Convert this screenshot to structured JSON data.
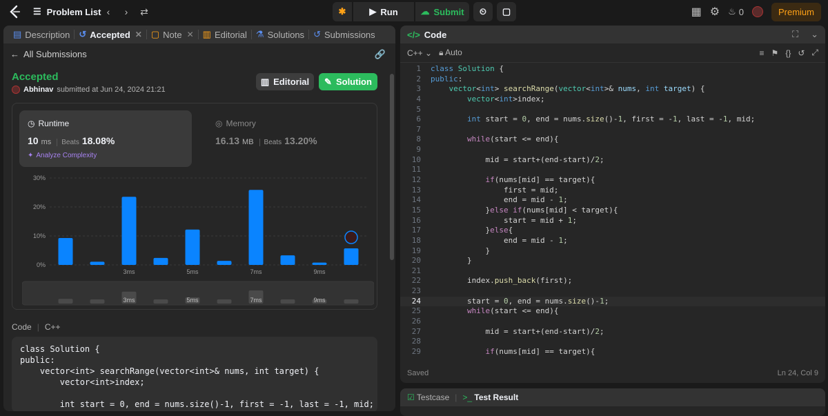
{
  "topbar": {
    "problem_list_label": "Problem List",
    "run_label": "Run",
    "submit_label": "Submit",
    "streak_count": "0",
    "premium_label": "Premium"
  },
  "left_tabs": [
    {
      "label": "Description"
    },
    {
      "label": "Accepted"
    },
    {
      "label": "Note"
    },
    {
      "label": "Editorial"
    },
    {
      "label": "Solutions"
    },
    {
      "label": "Submissions"
    }
  ],
  "submission": {
    "back_label": "All Submissions",
    "status": "Accepted",
    "user": "Abhinav",
    "submitted_text": "submitted at Jun 24, 2024 21:21",
    "editorial_btn": "Editorial",
    "solution_btn": "Solution",
    "runtime_title": "Runtime",
    "runtime_value": "10",
    "runtime_unit": "ms",
    "beats_label": "Beats",
    "runtime_beats": "18.08%",
    "analyze_label": "Analyze Complexity",
    "memory_title": "Memory",
    "memory_value": "16.13",
    "memory_unit": "MB",
    "memory_beats": "13.20%"
  },
  "chart_data": {
    "type": "bar",
    "y_ticks": [
      "30%",
      "20%",
      "10%",
      "0%"
    ],
    "x_tick_labels": [
      "3ms",
      "5ms",
      "7ms",
      "9ms"
    ],
    "values": [
      9.3,
      1.1,
      23.5,
      2.4,
      12.2,
      1.4,
      25.9,
      3.3,
      0.8,
      5.7
    ],
    "ylim": [
      0,
      30
    ],
    "highlight_index": 9
  },
  "code_section": {
    "label": "Code",
    "lang": "C++",
    "preview_lines": [
      "class Solution {",
      "public:",
      "    vector<int> searchRange(vector<int>& nums, int target) {",
      "        vector<int>index;",
      "",
      "        int start = 0, end = nums.size()-1, first = -1, last = -1, mid;"
    ]
  },
  "editor": {
    "title": "Code",
    "language": "C++",
    "mode": "Auto",
    "status_left": "Saved",
    "status_right": "Ln 24, Col 9",
    "current_line": 24
  },
  "bottom_panel": {
    "testcase_label": "Testcase",
    "result_label": "Test Result"
  },
  "colors": {
    "accent_green": "#2cbb5d",
    "bar_blue": "#0a84ff",
    "premium_orange": "#ffa116"
  }
}
